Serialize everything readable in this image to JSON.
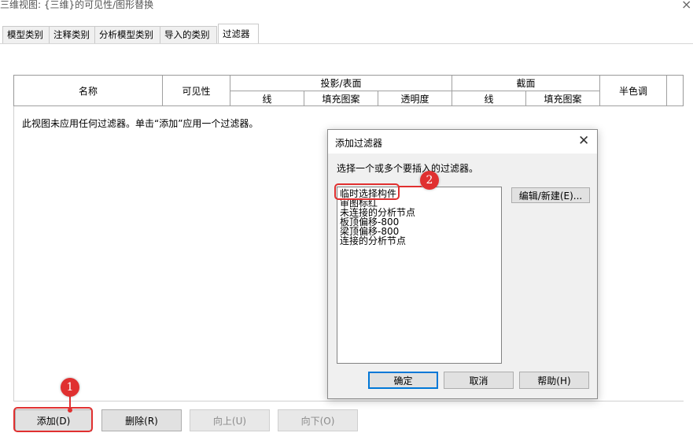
{
  "window": {
    "title": "三维视图: {三维}的可见性/图形替换",
    "close_glyph": "×"
  },
  "tabs": [
    {
      "label": "模型类别"
    },
    {
      "label": "注释类别"
    },
    {
      "label": "分析模型类别"
    },
    {
      "label": "导入的类别"
    },
    {
      "label": "过滤器",
      "active": true
    }
  ],
  "grid": {
    "columns": {
      "name": "名称",
      "visibility": "可见性",
      "projection_surface": "投影/表面",
      "projection_line": "线",
      "projection_fill": "填充图案",
      "projection_transparency": "透明度",
      "cut": "截面",
      "cut_line": "线",
      "cut_fill": "填充图案",
      "halftone": "半色调"
    },
    "empty_message": "此视图未应用任何过滤器。单击“添加”应用一个过滤器。"
  },
  "buttons": {
    "add": "添加(D)",
    "delete": "删除(R)",
    "up": "向上(U)",
    "down": "向下(O)"
  },
  "dialog": {
    "title": "添加过滤器",
    "close_glyph": "✕",
    "prompt": "选择一个或多个要插入的过滤器。",
    "filters": [
      "临时选择构件",
      "审图标红",
      "未连接的分析节点",
      "板顶偏移-800",
      "梁顶偏移-800",
      "连接的分析节点"
    ],
    "edit_button": "编辑/新建(E)...",
    "ok": "确定",
    "cancel": "取消",
    "help": "帮助(H)"
  },
  "annotations": {
    "callout_1": "1",
    "callout_2": "2",
    "color": "#e03030"
  }
}
